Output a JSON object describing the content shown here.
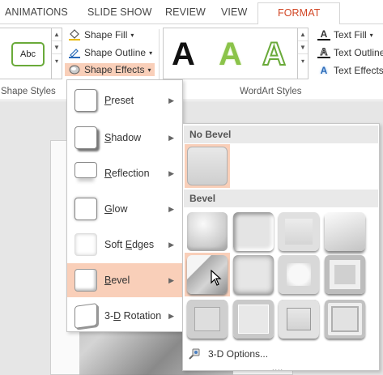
{
  "tabs": [
    {
      "label": "ANIMATIONS"
    },
    {
      "label": "SLIDE SHOW"
    },
    {
      "label": "REVIEW"
    },
    {
      "label": "VIEW"
    },
    {
      "label": "FORMAT"
    }
  ],
  "shape_styles": {
    "thumb_label": "Abc",
    "fill_label": "Shape Fill",
    "outline_label": "Shape Outline",
    "effects_label": "Shape Effects",
    "group_label": "Shape Styles"
  },
  "wordart_styles": {
    "letters": [
      "A",
      "A",
      "A"
    ],
    "text_fill_label": "Text Fill",
    "text_outline_label": "Text Outline",
    "text_effects_label": "Text Effects",
    "group_label": "WordArt Styles"
  },
  "effects_menu": {
    "items": [
      {
        "label": "Preset",
        "underline": "P"
      },
      {
        "label": "Shadow",
        "underline": "S"
      },
      {
        "label": "Reflection",
        "underline": "R"
      },
      {
        "label": "Glow",
        "underline": "G"
      },
      {
        "label": "Soft Edges",
        "underline": "E"
      },
      {
        "label": "Bevel",
        "underline": "B"
      },
      {
        "label": "3-D Rotation",
        "underline": "D"
      }
    ],
    "selected": "Bevel"
  },
  "bevel_menu": {
    "no_bevel_header": "No Bevel",
    "bevel_header": "Bevel",
    "options_label": "3-D Options...",
    "grip": "....",
    "hovered_index": 4
  },
  "colors": {
    "accent": "#d24726",
    "highlight": "#f9cfb9",
    "wordart_green": "#6aaa3a"
  }
}
